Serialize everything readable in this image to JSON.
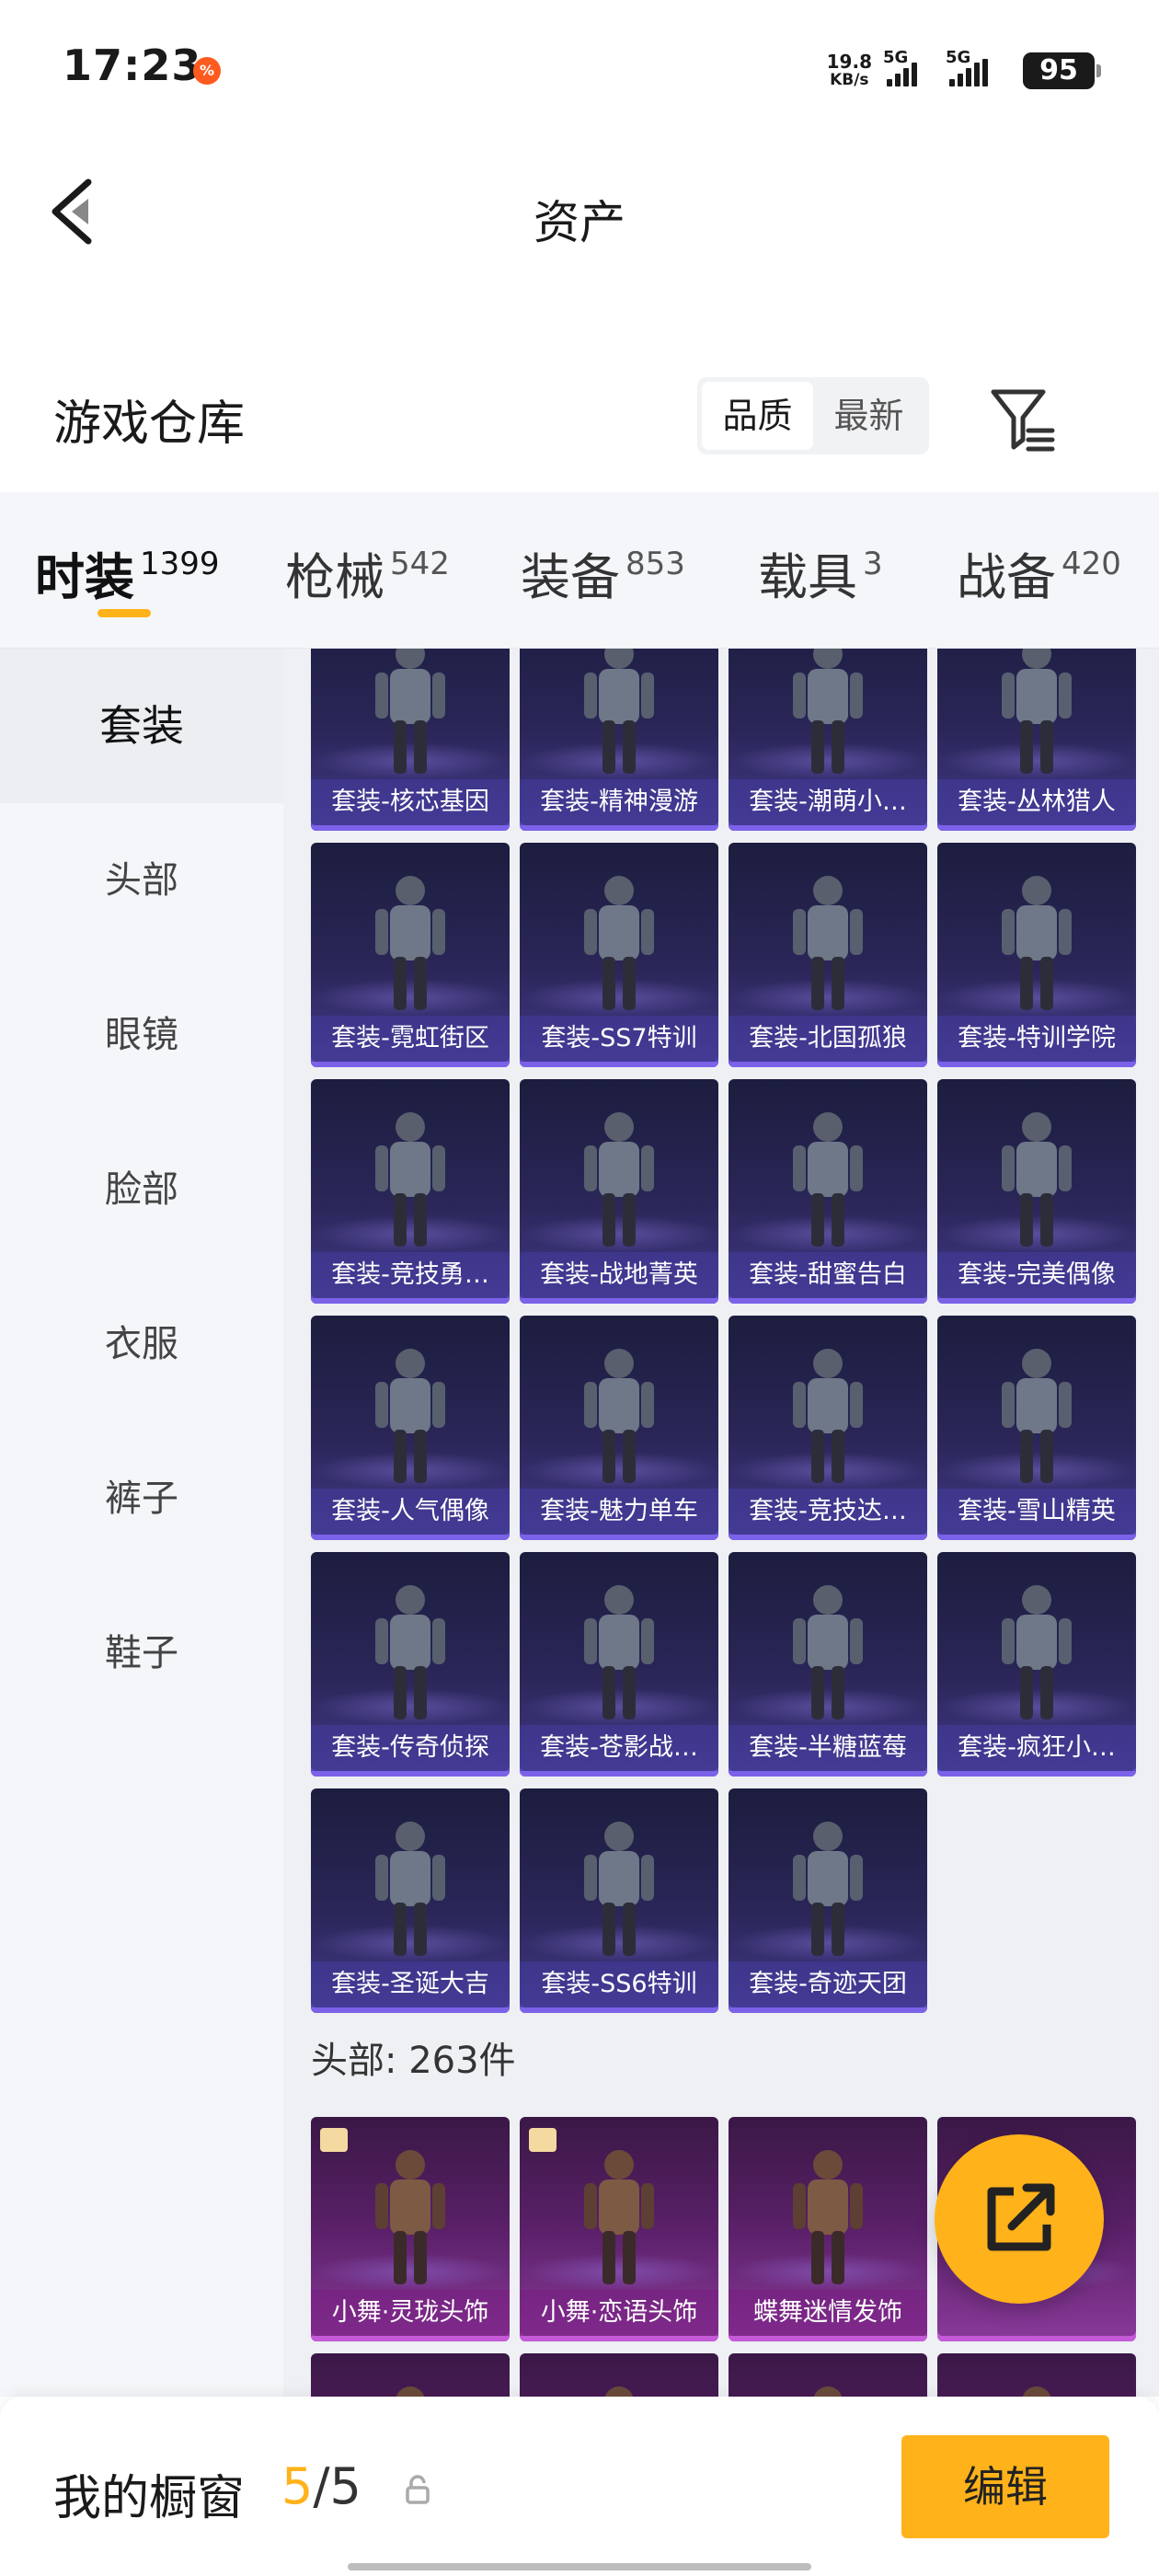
{
  "status_bar": {
    "time": "17:23",
    "net_speed_value": "19.8",
    "net_speed_unit": "KB/s",
    "sim1": "5G",
    "sim2": "5G",
    "battery": "95"
  },
  "title_bar": {
    "title": "资产"
  },
  "warehouse": {
    "title": "游戏仓库",
    "sort_options": [
      "品质",
      "最新"
    ],
    "sort_selected": "品质"
  },
  "tabs": [
    {
      "label": "时装",
      "count": "1399"
    },
    {
      "label": "枪械",
      "count": "542"
    },
    {
      "label": "装备",
      "count": "853"
    },
    {
      "label": "载具",
      "count": "3"
    },
    {
      "label": "战备",
      "count": "420"
    }
  ],
  "sidebar": [
    "套装",
    "头部",
    "眼镜",
    "脸部",
    "衣服",
    "裤子",
    "鞋子"
  ],
  "suits": [
    "套装-核芯基因",
    "套装-精神漫游",
    "套装-潮萌小…",
    "套装-丛林猎人",
    "套装-霓虹街区",
    "套装-SS7特训",
    "套装-北国孤狼",
    "套装-特训学院",
    "套装-竞技勇…",
    "套装-战地菁英",
    "套装-甜蜜告白",
    "套装-完美偶像",
    "套装-人气偶像",
    "套装-魅力单车",
    "套装-竞技达…",
    "套装-雪山精英",
    "套装-传奇侦探",
    "套装-苍影战…",
    "套装-半糖蓝莓",
    "套装-疯狂小…",
    "套装-圣诞大吉",
    "套装-SS6特训",
    "套装-奇迹天团"
  ],
  "head_section": {
    "title": "头部: 263件"
  },
  "head_items": [
    "小舞·灵珑头饰",
    "小舞·恋语头饰",
    "蝶舞迷情发饰",
    "",
    "",
    "",
    "",
    ""
  ],
  "bottom_bar": {
    "showcase_label": "我的橱窗",
    "showcase_current": "5",
    "showcase_total": "/5",
    "edit_label": "编辑"
  },
  "colors": {
    "accent": "#ffb21a",
    "suit_tile": "#2a2658",
    "head_tile": "#5a2068"
  }
}
